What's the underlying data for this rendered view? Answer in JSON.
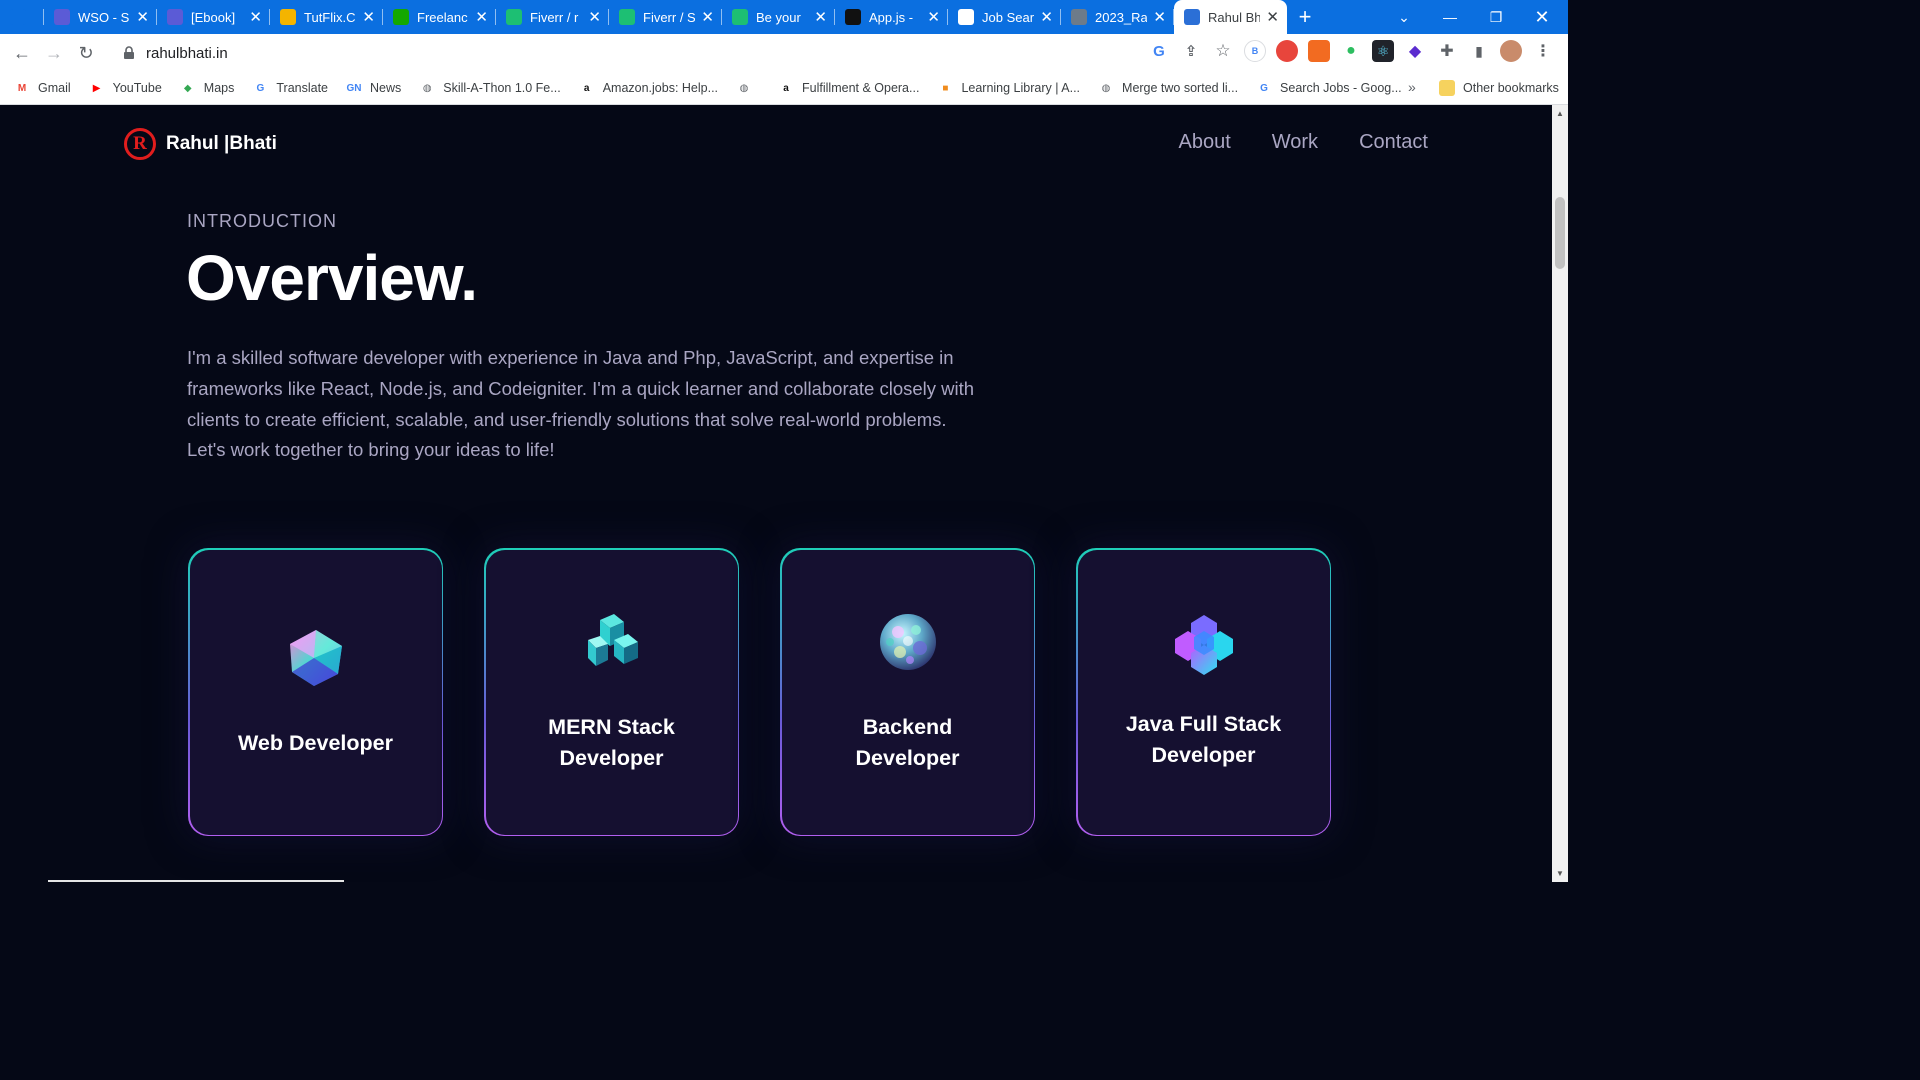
{
  "browser": {
    "tabs": [
      {
        "title": "",
        "icon": "diamond-icon",
        "color": "#0b6fe0"
      },
      {
        "title": "WSO - S",
        "icon": "tf-icon",
        "color": "#5b5bd6"
      },
      {
        "title": "[Ebook] ",
        "icon": "tf-icon",
        "color": "#5b5bd6"
      },
      {
        "title": "TutFlix.C",
        "icon": "drive-icon",
        "color": "#f4b400"
      },
      {
        "title": "Freelanc",
        "icon": "upwork-icon",
        "color": "#14a800"
      },
      {
        "title": "Fiverr / r",
        "icon": "fiverr-icon",
        "color": "#1dbf73"
      },
      {
        "title": "Fiverr / S",
        "icon": "fiverr-icon",
        "color": "#1dbf73"
      },
      {
        "title": "Be your ",
        "icon": "fiverr-icon",
        "color": "#1dbf73"
      },
      {
        "title": "App.js - ",
        "icon": "github-icon",
        "color": "#111111"
      },
      {
        "title": "Job Sear",
        "icon": "info-icon",
        "color": "#ffffff"
      },
      {
        "title": "2023_Ra",
        "icon": "globe-icon",
        "color": "#6d7b8a"
      },
      {
        "title": "Rahul Bh",
        "icon": "rb-icon",
        "color": "#2b6fd6",
        "active": true
      }
    ],
    "new_tab_label": "+",
    "url": "rahulbhati.in",
    "bookmarks": [
      {
        "label": "Gmail",
        "icon": "gmail-icon",
        "color": "#ea4335",
        "glyph": "M"
      },
      {
        "label": "YouTube",
        "icon": "youtube-icon",
        "color": "#ff0000",
        "glyph": "▶"
      },
      {
        "label": "Maps",
        "icon": "maps-icon",
        "color": "#34a853",
        "glyph": "◆"
      },
      {
        "label": "Translate",
        "icon": "translate-icon",
        "color": "#4285f4",
        "glyph": "G"
      },
      {
        "label": "News",
        "icon": "news-icon",
        "color": "#4285f4",
        "glyph": "GN"
      },
      {
        "label": "Skill-A-Thon 1.0 Fe...",
        "icon": "globe-icon",
        "color": "#5f6368",
        "glyph": "◍"
      },
      {
        "label": "Amazon.jobs: Help...",
        "icon": "amazon-icon",
        "color": "#111111",
        "glyph": "a"
      },
      {
        "label": "",
        "icon": "globe-icon",
        "color": "#5f6368",
        "glyph": "◍"
      },
      {
        "label": "Fulfillment & Opera...",
        "icon": "amazon-icon",
        "color": "#111111",
        "glyph": "a"
      },
      {
        "label": "Learning Library | A...",
        "icon": "cube-icon",
        "color": "#f08c1e",
        "glyph": "■"
      },
      {
        "label": "Merge two sorted li...",
        "icon": "globe-icon",
        "color": "#5f6368",
        "glyph": "◍"
      },
      {
        "label": "Search Jobs - Goog...",
        "icon": "google-icon",
        "color": "#4285f4",
        "glyph": "G"
      }
    ],
    "more_bookmarks": "»",
    "other_bookmarks": "Other bookmarks"
  },
  "site": {
    "logo_letter": "R",
    "logo_name": "Rahul |Bhati",
    "nav": [
      "About",
      "Work",
      "Contact"
    ],
    "eyebrow": "INTRODUCTION",
    "heading": "Overview.",
    "paragraph": "I'm a skilled software developer with experience in Java and Php, JavaScript, and expertise in frameworks like React, Node.js, and Codeigniter. I'm a quick learner and collaborate closely with clients to create efficient, scalable, and user-friendly solutions that solve real-world problems. Let's work together to bring your ideas to life!",
    "cards": [
      {
        "title": "Web Developer",
        "icon": "gem-icon"
      },
      {
        "title": "MERN Stack Developer",
        "icon": "cube-cluster-icon"
      },
      {
        "title": "Backend Developer",
        "icon": "sphere-icon"
      },
      {
        "title": "Java Full Stack Developer",
        "icon": "hexagon-icon"
      }
    ]
  }
}
